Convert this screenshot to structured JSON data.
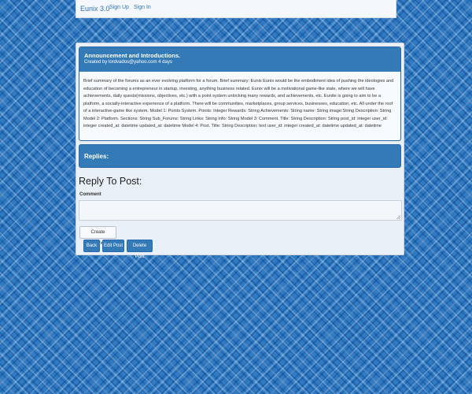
{
  "navbar": {
    "brand": "Eunix 3.0",
    "links": [
      "Sign Up",
      "Sign In"
    ]
  },
  "post": {
    "title": "Announcement and Introductions.",
    "meta": "Created by lordvados@yahoo.com 4 days",
    "body": "Brief summary of the forums as an ever evolving platform for a forum. Brief summary: Eunix Eunix would be the embodiment idea of pushing the ideologies and education of becoming a entrepreneur in startup, investing, anything business related. Eunix will be a motivational game-like state, where we will have achievements, daily quests(missions, objectives, etc.) with a point system unlocking many rewards, and achievements, etc. Eunite is going to aim to be a platform, a socially-interactive experience of a platform. There will be communities, marketplaces, group services, businesses, education, etc. All under the roof of a interactive-game like system. Model 1: Points System. Points: Integer Rewards: String Achievements: String name: String image:String Description: String Model 2: Platform. Sections: String Sub_Forums: String Links: String Info: String Model 3: Comment. Title: String Description: String post_id: integer user_id: integer created_at: datetime updated_at: datetime Model 4: Post. Title: String Description: text user_id: integer created_at: datetime updated_at: datetime"
  },
  "replies": {
    "heading": "Replies:"
  },
  "reply_form": {
    "heading": "Reply To Post:",
    "comment_label": "Comment",
    "comment_value": "",
    "submit_label": "Create Comment"
  },
  "actions": {
    "back": "Back",
    "edit": "Edit Post",
    "delete": "Delete Post"
  }
}
